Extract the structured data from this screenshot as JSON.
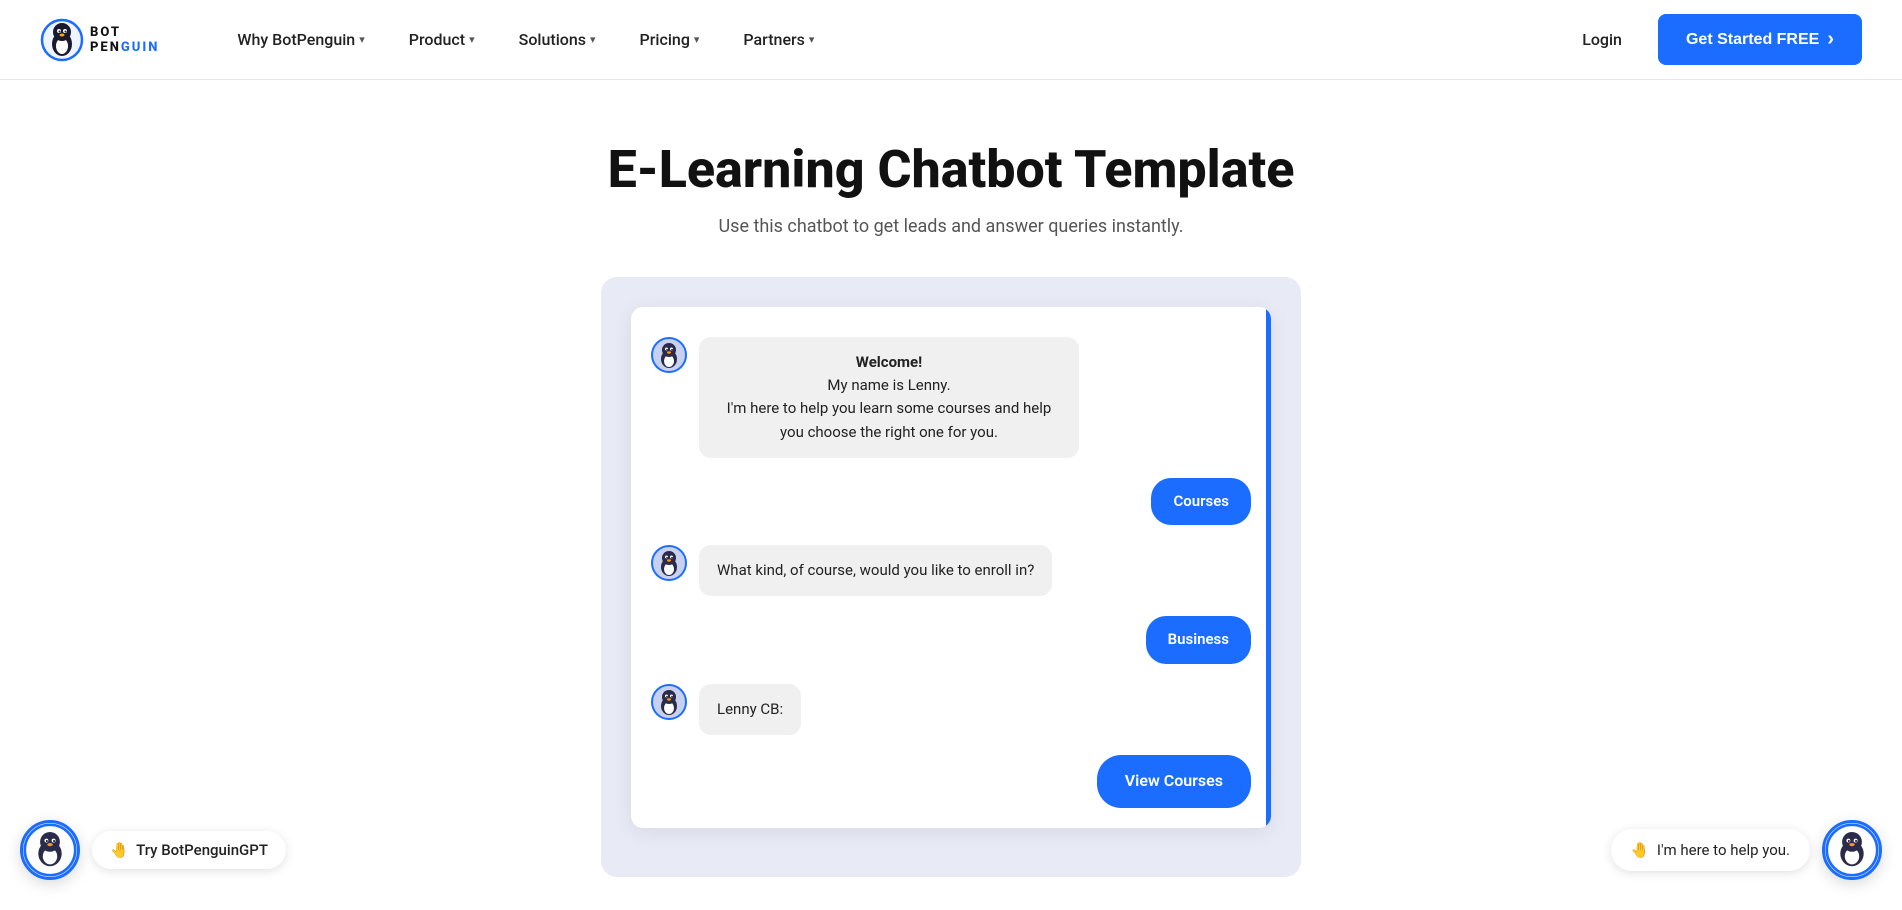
{
  "navbar": {
    "logo_line1": "BOT",
    "logo_line2_plain": "PEN",
    "logo_line2_colored": "GUIN",
    "nav_items": [
      {
        "label": "Why BotPenguin",
        "has_chevron": true
      },
      {
        "label": "Product",
        "has_chevron": true
      },
      {
        "label": "Solutions",
        "has_chevron": true
      },
      {
        "label": "Pricing",
        "has_chevron": true
      },
      {
        "label": "Partners",
        "has_chevron": true
      }
    ],
    "login_label": "Login",
    "cta_label": "Get Started FREE",
    "cta_arrow": "›"
  },
  "hero": {
    "title": "E-Learning Chatbot Template",
    "subtitle": "Use this chatbot to get leads and answer queries instantly."
  },
  "chat": {
    "messages": [
      {
        "type": "bot",
        "text_lines": [
          "Welcome!",
          "My name is Lenny.",
          "I'm here to help you learn some courses and help you choose the right one for you."
        ]
      },
      {
        "type": "user",
        "text": "Courses"
      },
      {
        "type": "bot",
        "text_lines": [
          "What kind, of course, would you like to enroll in?"
        ]
      },
      {
        "type": "user",
        "text": "Business"
      },
      {
        "type": "bot",
        "text_lines": [
          "Lenny CB:"
        ]
      },
      {
        "type": "user",
        "text": "View Courses"
      }
    ]
  },
  "widget_left": {
    "icon": "🤖",
    "badge": "🤚",
    "text": "Try BotPenguinGPT"
  },
  "widget_right": {
    "icon": "🤖",
    "badge": "🤚",
    "text": "I'm here to help you."
  }
}
